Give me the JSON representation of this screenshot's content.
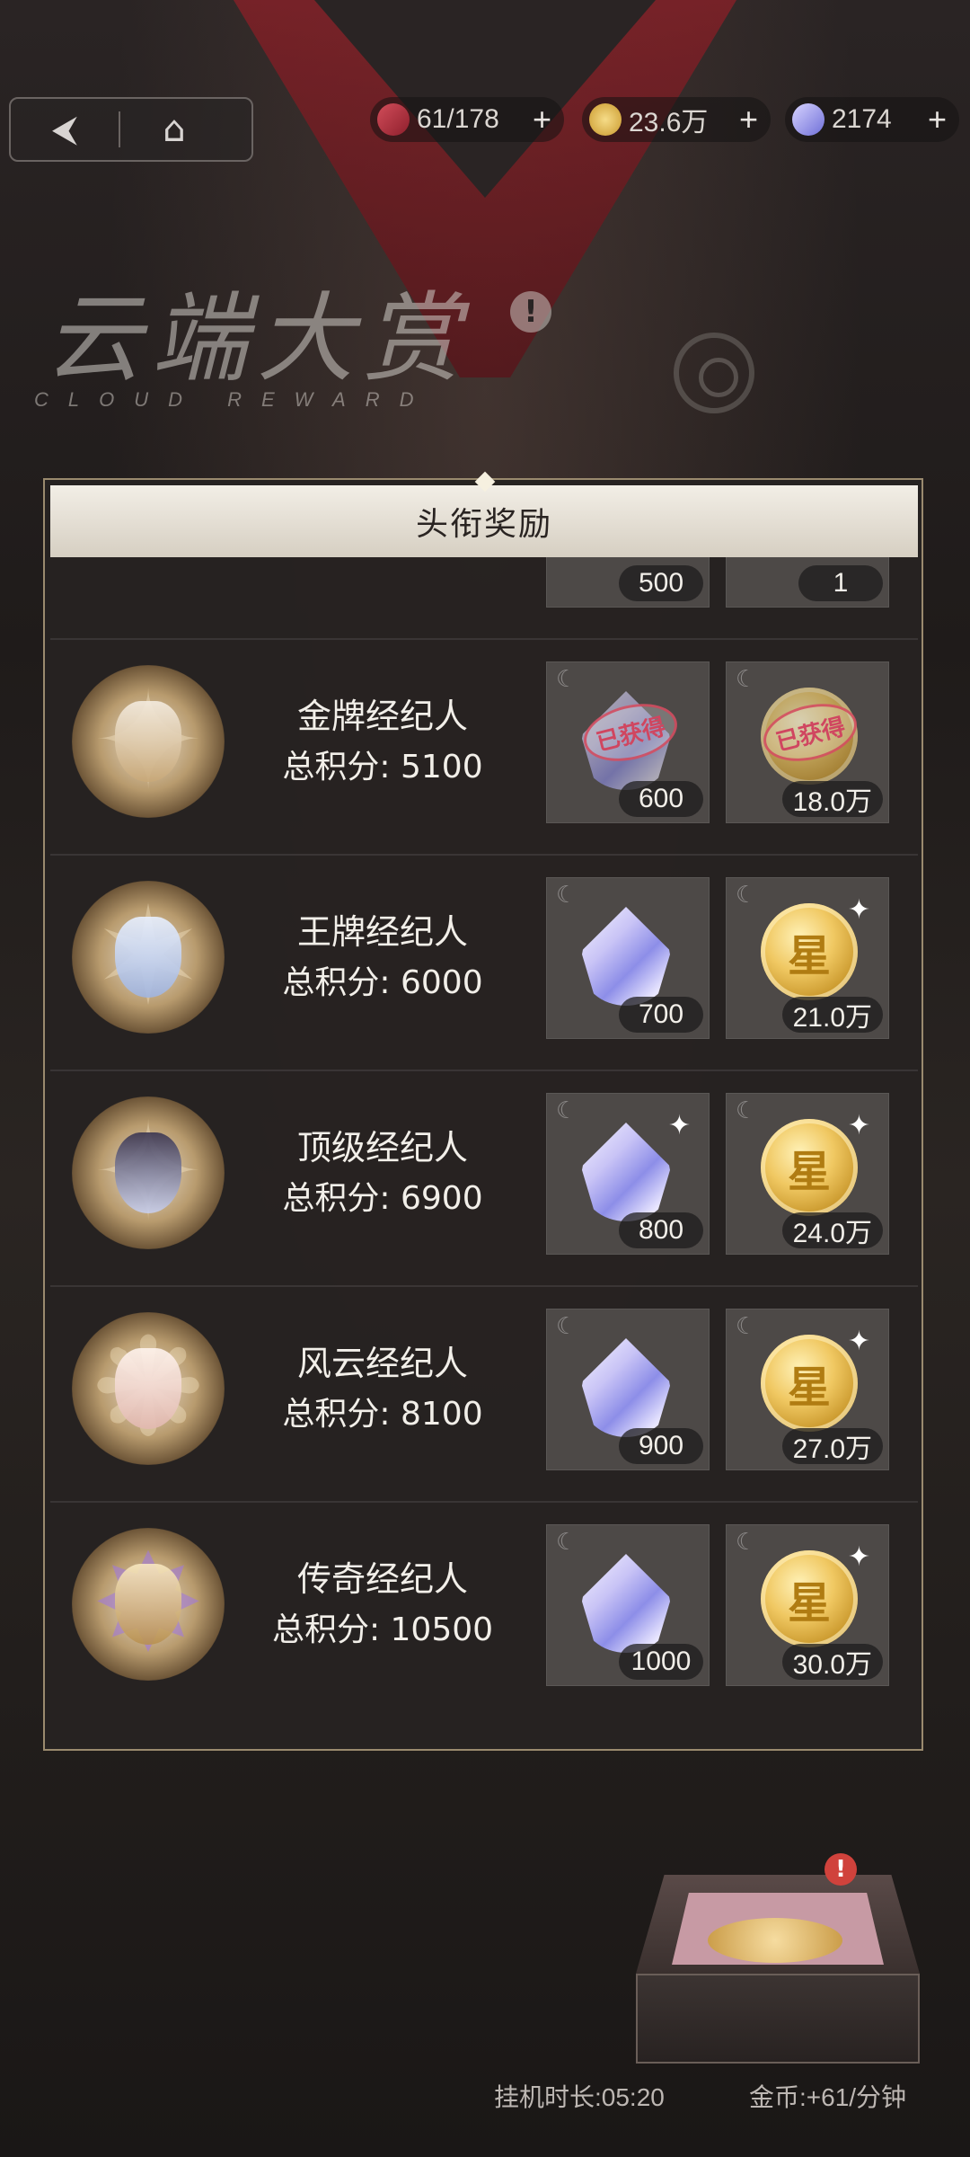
{
  "topbar": {
    "back_icon": "back-arrow-icon",
    "home_icon": "home-icon",
    "stamina": "61/178",
    "gold": "23.6万",
    "diamond": "2174",
    "plus_label": "+"
  },
  "header": {
    "title_cn": "云端大赏",
    "title_en": "CLOUD REWARD",
    "alert": "!"
  },
  "panel": {
    "title": "头衔奖励",
    "partial_row": {
      "diamond_qty": "500",
      "item_qty": "1"
    },
    "rows": [
      {
        "name": "金牌经纪人",
        "score_label": "总积分:",
        "score": "5100",
        "diamond_qty": "600",
        "coin_qty": "18.0万",
        "claimed": true,
        "claimed_label": "已获得"
      },
      {
        "name": "王牌经纪人",
        "score_label": "总积分:",
        "score": "6000",
        "diamond_qty": "700",
        "coin_qty": "21.0万",
        "claimed": false
      },
      {
        "name": "顶级经纪人",
        "score_label": "总积分:",
        "score": "6900",
        "diamond_qty": "800",
        "coin_qty": "24.0万",
        "claimed": false
      },
      {
        "name": "风云经纪人",
        "score_label": "总积分:",
        "score": "8100",
        "diamond_qty": "900",
        "coin_qty": "27.0万",
        "claimed": false
      },
      {
        "name": "传奇经纪人",
        "score_label": "总积分:",
        "score": "10500",
        "diamond_qty": "1000",
        "coin_qty": "30.0万",
        "claimed": false
      }
    ],
    "coin_glyph": "星"
  },
  "footer": {
    "idle_time": "挂机时长:05:20",
    "gold_rate": "金币:+61/分钟",
    "chest_badge": "!"
  },
  "colors": {
    "accent_red": "#8c1f27",
    "panel_border": "#9a8a6e",
    "claimed_stamp": "#d04660"
  }
}
